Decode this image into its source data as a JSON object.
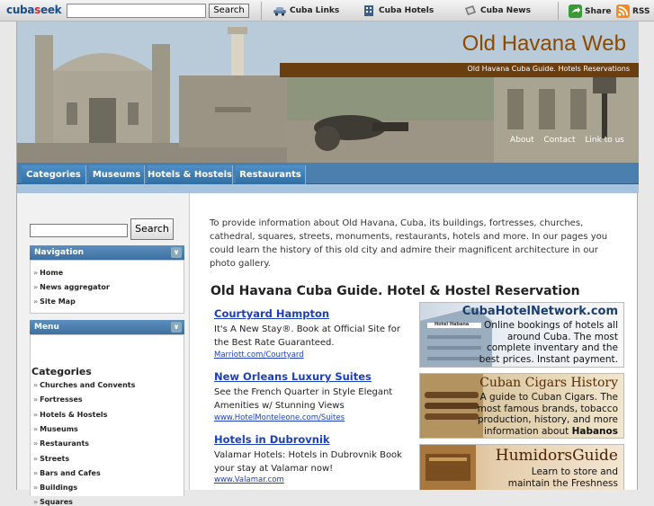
{
  "topbar": {
    "logo_a": "cuba",
    "logo_o": "s",
    "logo_b": "eek",
    "search_label": "Search",
    "links": [
      {
        "label": "Cuba Links",
        "icon": "car-icon"
      },
      {
        "label": "Cuba Hotels",
        "icon": "building-icon"
      },
      {
        "label": "Cuba News",
        "icon": "newspaper-icon"
      }
    ],
    "share_label": "Share",
    "rss_label": "RSS"
  },
  "banner": {
    "title": "Old Havana Web",
    "subtitle": "Old Havana Cuba Guide. Hotels Reservations",
    "links": [
      "About",
      "Contact",
      "Link to us"
    ]
  },
  "nav_tabs": [
    "Categories",
    "Museums",
    "Hotels & Hostels",
    "Restaurants"
  ],
  "sidebar": {
    "search_label": "Search",
    "navigation_title": "Navigation",
    "navigation_items": [
      "Home",
      "News aggregator",
      "Site Map"
    ],
    "menu_title": "Menu",
    "categories_title": "Categories",
    "categories": [
      "Churches and Convents",
      "Fortresses",
      "Hotels & Hostels",
      "Museums",
      "Restaurants",
      "Streets",
      "Bars and Cafes",
      "Buildings",
      "Squares"
    ]
  },
  "main": {
    "intro": "To provide information about Old Havana, Cuba, its buildings, fortresses, churches, cathedral, squares, streets, monuments, restaurants, hotels and more. In our pages you could learn the history of this old city and admire their magnificent architecture in our photo gallery.",
    "guide_title": "Old Havana Cuba Guide. Hotel & Hostel Reservation",
    "ads": [
      {
        "title": "Courtyard Hampton",
        "text": "It's A New Stay®. Book at Official Site for the Best Rate Guaranteed.",
        "url": "Marriott.com/Courtyard"
      },
      {
        "title": "New Orleans Luxury Suites",
        "text": "See the French Quarter in Style Elegant Amenities w/ Stunning Views",
        "url": "www.HotelMonteleone.com/Suites"
      },
      {
        "title": "Hotels in Dubrovnik",
        "text": "Valamar Hotels: Hotels in Dubrovnik Book your stay at Valamar now!",
        "url": "www.Valamar.com"
      }
    ],
    "promos": [
      {
        "brand": "CubaHotelNetwork.com",
        "text": "Online bookings of hotels all around Cuba. The most complete inventary and the best prices. Instant payment.",
        "sign": "Hotel Habana"
      },
      {
        "brand": "Cuban Cigars History",
        "text_a": "A guide to Cuban Cigars. The most famous brands, tobacco production, history, and more information about ",
        "text_b": "Habanos"
      },
      {
        "brand": "HumidorsGuide",
        "text": "Learn to store and maintain the Freshness"
      }
    ]
  }
}
